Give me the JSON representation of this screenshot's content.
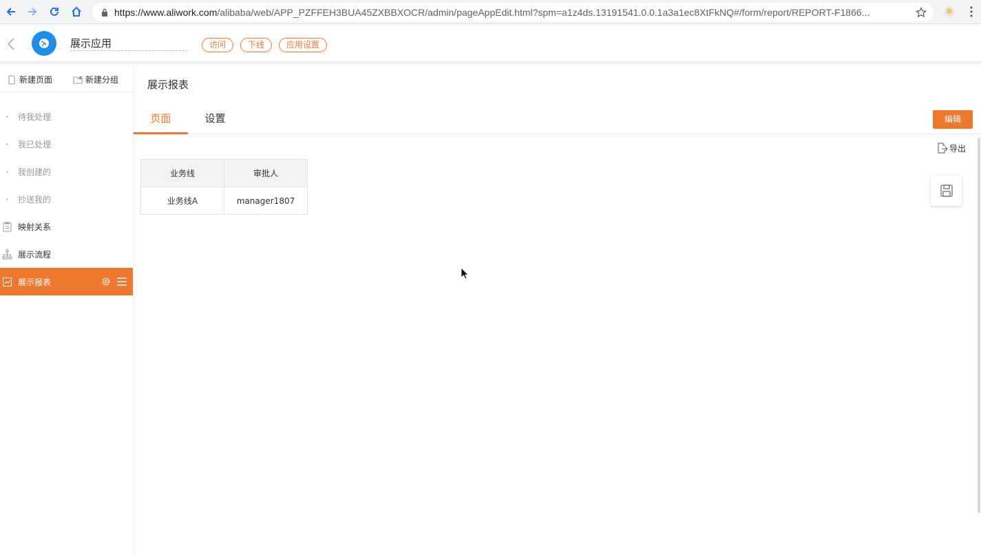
{
  "browser": {
    "url_host": "https://www.aliwork.com",
    "url_rest": "/alibaba/web/APP_PZFFEH3BUA45ZXBBXOCR/admin/pageAppEdit.html?spm=a1z4ds.13191541.0.0.1a3a1ec8XtFkNQ#/form/report/REPORT-F1866..."
  },
  "header": {
    "app_name": "展示应用",
    "buttons": [
      "访问",
      "下线",
      "应用设置"
    ]
  },
  "sidebar": {
    "new_page": "新建页面",
    "new_group": "新建分组",
    "items": [
      {
        "label": "待我处理"
      },
      {
        "label": "我已处理"
      },
      {
        "label": "我创建的"
      },
      {
        "label": "抄送我的"
      },
      {
        "label": "映射关系"
      },
      {
        "label": "展示流程"
      },
      {
        "label": "展示报表"
      }
    ]
  },
  "main": {
    "title": "展示报表",
    "tabs": [
      {
        "label": "页面"
      },
      {
        "label": "设置"
      }
    ],
    "edit_label": "编辑",
    "export_label": "导出",
    "table": {
      "headers": [
        "业务线",
        "审批人"
      ],
      "rows": [
        [
          "业务线A",
          "manager1807"
        ]
      ]
    }
  },
  "colors": {
    "accent": "#f0772e",
    "logo": "#1e8fe8"
  }
}
